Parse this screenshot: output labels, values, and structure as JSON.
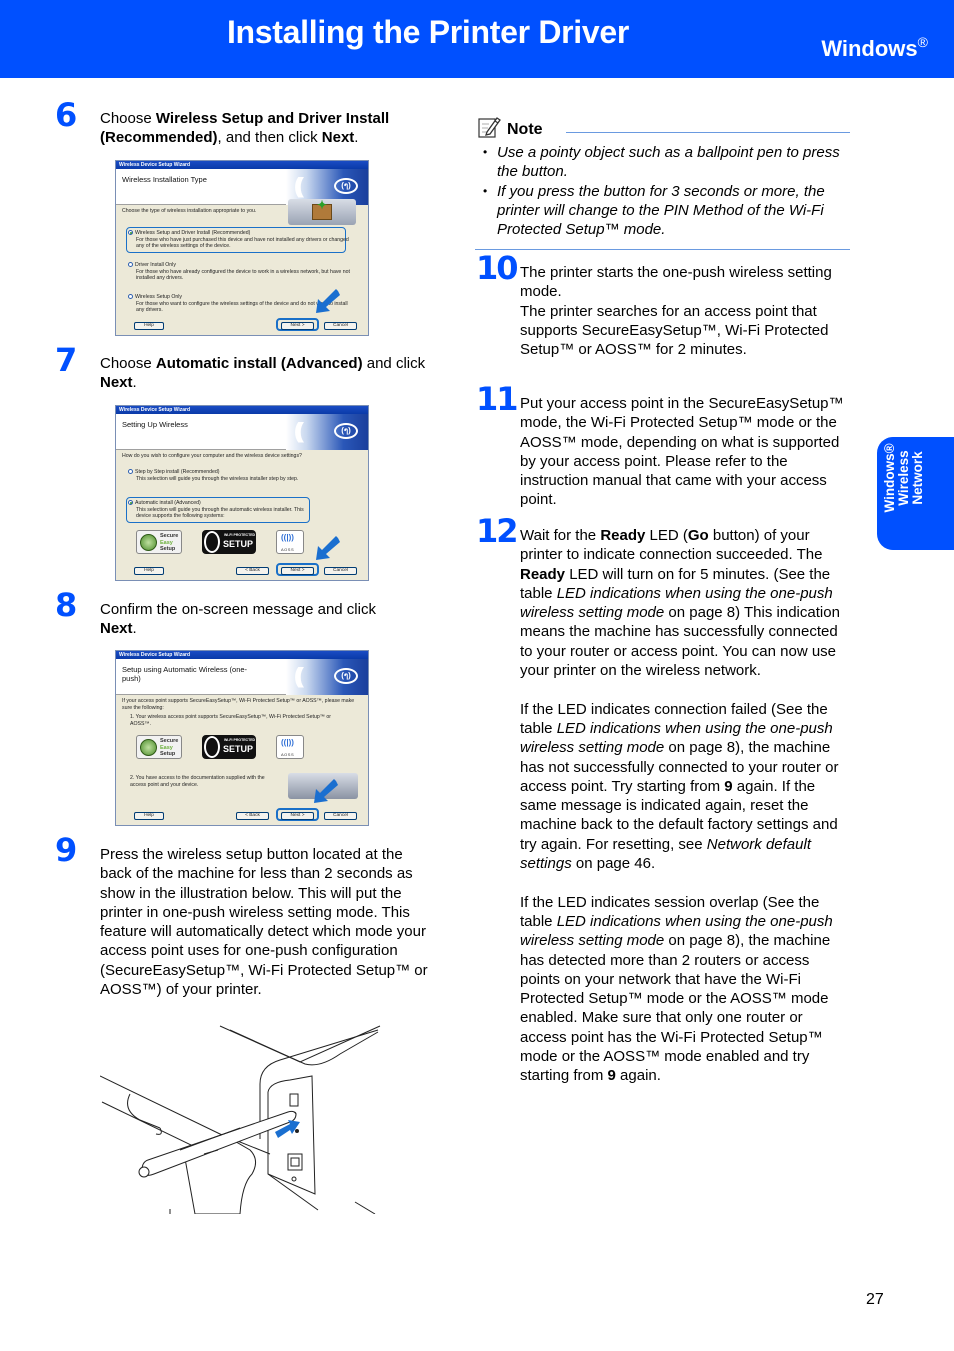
{
  "header": {
    "title": "Installing the Printer Driver",
    "os_label": "Windows",
    "os_mark": "®"
  },
  "side_tab": {
    "lines": [
      "Windows®",
      "Wireless",
      "Network"
    ]
  },
  "steps": [
    {
      "number": "6",
      "text_parts": [
        "Choose ",
        "Wireless Setup and Driver Install (Recommended)",
        ", and then click ",
        "Next",
        "."
      ],
      "dialog": {
        "window_title": "Wireless Device Setup Wizard",
        "heading": "Wireless Installation Type",
        "question": "Choose the type of wireless installation appropriate to you.",
        "options": [
          {
            "label": "Wireless Setup and Driver Install (Recommended)",
            "desc": "For those who have just purchased this device and have not installed any drivers or changed any of the wireless settings of the device.",
            "selected": true
          },
          {
            "label": "Driver Install Only",
            "desc": "For those who have already configured the device to work in a wireless network, but have not installed any drivers.",
            "selected": false
          },
          {
            "label": "Wireless Setup Only",
            "desc": "For those who want to configure the wireless settings of the device and do not want to install any drivers.",
            "selected": false
          }
        ],
        "buttons": {
          "help": "Help",
          "next": "Next >",
          "cancel": "Cancel"
        }
      }
    },
    {
      "number": "7",
      "text_parts": [
        "Choose ",
        "Automatic install (Advanced)",
        " and click ",
        "Next",
        "."
      ],
      "dialog": {
        "window_title": "Wireless Device Setup Wizard",
        "heading": "Setting Up Wireless",
        "question": "How do you wish to configure your computer and the wireless device settings?",
        "options": [
          {
            "label": "Step by Step install (Recommended)",
            "desc": "This selection will guide you through the wireless installer step by step.",
            "selected": false
          },
          {
            "label": "Automatic install (Advanced)",
            "desc": "This selection will guide you through the automatic wireless installer. This device supports the following systems:",
            "selected": true
          }
        ],
        "logos": {
          "ses": [
            "Secure",
            "Easy",
            "Setup"
          ],
          "wps_small": "Wi-Fi PROTECTED",
          "wps": "SETUP",
          "aoss": "AOSS"
        },
        "buttons": {
          "help": "Help",
          "back": "< Back",
          "next": "Next >",
          "cancel": "Cancel"
        }
      }
    },
    {
      "number": "8",
      "text_parts": [
        "Confirm the on-screen message and click ",
        "Next",
        "."
      ],
      "dialog": {
        "window_title": "Wireless Device Setup Wizard",
        "heading": "Setup using Automatic Wireless (one-push)",
        "question": "If your access point supports SecureEasySetup™, Wi-Fi Protected Setup™ or AOSS™, please make sure the following:",
        "item1": "1. Your wireless access point supports SecureEasySetup™, Wi-Fi Protected Setup™ or AOSS™.",
        "item2": "2. You have access to the documentation supplied with the access point and your device.",
        "logos": {
          "ses": [
            "Secure",
            "Easy",
            "Setup"
          ],
          "wps_small": "Wi-Fi PROTECTED",
          "wps": "SETUP",
          "aoss": "AOSS"
        },
        "buttons": {
          "help": "Help",
          "back": "< Back",
          "next": "Next >",
          "cancel": "Cancel"
        }
      }
    },
    {
      "number": "9",
      "text": "Press the wireless setup button located at the back of the machine for less than 2 seconds as show in the illustration below. This will put the printer in one-push wireless setting mode. This feature will automatically detect which mode your access point uses for one-push configuration (SecureEasySetup™, Wi-Fi Protected Setup™ or AOSS™) of your printer."
    },
    {
      "number": "10",
      "paragraphs": [
        "The printer starts the one-push wireless setting mode.",
        "The printer searches for an access point that supports SecureEasySetup™, Wi-Fi Protected Setup™ or AOSS™ for 2 minutes."
      ]
    },
    {
      "number": "11",
      "text": "Put your access point in the SecureEasySetup™ mode, the Wi-Fi Protected Setup™ mode or the AOSS™ mode, depending on what is supported by your access point. Please refer to the instruction manual that came with your access point."
    },
    {
      "number": "12",
      "p1": [
        "Wait for the ",
        "Ready",
        " LED (",
        "Go",
        " button) of your printer to indicate connection succeeded. The ",
        "Ready",
        " LED will turn on for 5 minutes. (See the table ",
        "LED indications when using the one-push wireless setting mode",
        " on page 8) This indication means the machine has successfully connected to your router or access point. You can now use your printer on the wireless network."
      ],
      "p2": [
        "If the LED indicates connection failed (See the table ",
        "LED indications when using the one-push wireless setting mode",
        " on page 8), the machine has not successfully connected to your router or access point. Try starting from ",
        "9",
        " again. If the same message is indicated again, reset the machine back to the default factory settings and try again. For resetting, see ",
        "Network default settings",
        " on page 46."
      ],
      "p3": [
        "If the LED indicates session overlap (See the table ",
        "LED indications when using the one-push wireless setting mode",
        " on page 8), the machine has detected more than 2 routers or access points on your network that have the Wi-Fi Protected Setup™ mode or the AOSS™ mode enabled. Make sure that only one router or access point has the Wi-Fi Protected Setup™ mode or the AOSS™ mode enabled and try starting from ",
        "9",
        " again."
      ]
    }
  ],
  "note": {
    "label": "Note",
    "items": [
      "Use a pointy object such as a ballpoint pen to press the button.",
      "If you press the button for 3 seconds or more, the printer will change to the PIN Method of the Wi-Fi Protected Setup™ mode."
    ]
  },
  "page_number": "27",
  "colors": {
    "brand_blue": "#0050ff",
    "rule_blue": "#6a9ae0"
  }
}
